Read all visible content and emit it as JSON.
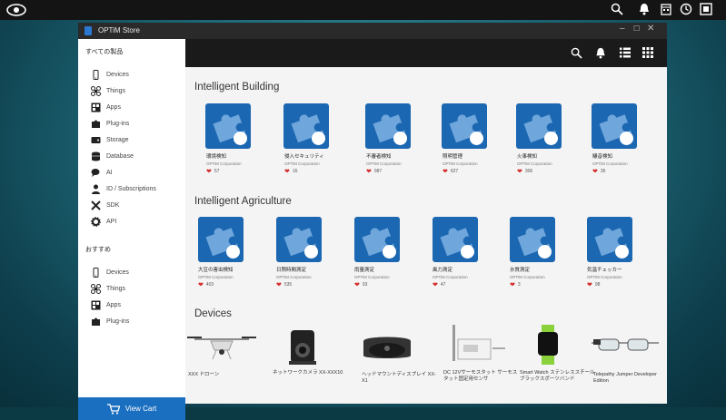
{
  "os": {
    "status_icons": [
      "search-icon",
      "bell-icon",
      "calendar-icon",
      "clock-icon",
      "window-icon"
    ]
  },
  "window": {
    "title": "OPTiM Store"
  },
  "sidebar": {
    "section_all": "すべての製品",
    "items": [
      {
        "label": "Devices",
        "icon": "phone-icon"
      },
      {
        "label": "Things",
        "icon": "drone-icon"
      },
      {
        "label": "Apps",
        "icon": "apps-icon"
      },
      {
        "label": "Plug-ins",
        "icon": "puzzle-icon"
      },
      {
        "label": "Storage",
        "icon": "storage-icon"
      },
      {
        "label": "Database",
        "icon": "database-icon"
      },
      {
        "label": "AI",
        "icon": "chat-icon"
      },
      {
        "label": "ID / Subscriptions",
        "icon": "person-icon"
      },
      {
        "label": "SDK",
        "icon": "tools-icon"
      },
      {
        "label": "API",
        "icon": "gear-icon"
      }
    ],
    "section_rec": "おすすめ",
    "rec_items": [
      {
        "label": "Devices",
        "icon": "phone-icon"
      },
      {
        "label": "Things",
        "icon": "drone-icon"
      },
      {
        "label": "Apps",
        "icon": "apps-icon"
      },
      {
        "label": "Plug-ins",
        "icon": "puzzle-icon"
      }
    ],
    "view_cart": "View Cart"
  },
  "sections": [
    {
      "title": "Intelligent Building",
      "items": [
        {
          "name": "環境検知",
          "corp": "OPTiM Corporation",
          "likes": "57",
          "badge": "sensor-icon"
        },
        {
          "name": "侵入セキュリティ",
          "corp": "OPTiM Corporation",
          "likes": "16",
          "badge": "camera-icon"
        },
        {
          "name": "不審者検知",
          "corp": "OPTiM Corporation",
          "likes": "987",
          "badge": "no-person-icon"
        },
        {
          "name": "照明管理",
          "corp": "OPTiM Corporation",
          "likes": "627",
          "badge": "bulb-icon"
        },
        {
          "name": "火事検知",
          "corp": "OPTiM Corporation",
          "likes": "306",
          "badge": "fire-icon"
        },
        {
          "name": "騒音検知",
          "corp": "OPTiM Corporation",
          "likes": "36",
          "badge": "mic-icon"
        }
      ]
    },
    {
      "title": "Intelligent Agriculture",
      "items": [
        {
          "name": "大豆の害虫検知",
          "corp": "OPTiM Corporation",
          "likes": "403",
          "badge": "camera-icon"
        },
        {
          "name": "日照時間測定",
          "corp": "OPTiM Corporation",
          "likes": "535",
          "badge": "sun-icon"
        },
        {
          "name": "雨量測定",
          "corp": "OPTiM Corporation",
          "likes": "93",
          "badge": "cloud-icon"
        },
        {
          "name": "風力測定",
          "corp": "OPTiM Corporation",
          "likes": "47",
          "badge": "wind-icon"
        },
        {
          "name": "水質測定",
          "corp": "OPTiM Corporation",
          "likes": "3",
          "badge": "water-icon"
        },
        {
          "name": "気温チェッカー",
          "corp": "OPTiM Corporation",
          "likes": "98",
          "badge": "thermometer-icon"
        }
      ]
    }
  ],
  "devices_title": "Devices",
  "devices": [
    {
      "name": "XXX ドローン",
      "icon": "drone-icon"
    },
    {
      "name": "ネットワークカメラ XX-XXX10",
      "icon": "network-camera-icon"
    },
    {
      "name": "ヘッドマウントディスプレイ XX-X1",
      "icon": "vr-headset-icon"
    },
    {
      "name": "DC 12Vサーモスタット サーモスタット固定用センサ",
      "icon": "thermostat-icon"
    },
    {
      "name": "Smart Watch ステンレススチール ブラックスポーツバンド",
      "icon": "smartwatch-icon"
    },
    {
      "name": "Telepathy Jumper Developer Edition",
      "icon": "smart-glasses-icon"
    }
  ],
  "colors": {
    "tile": "#1c67b1",
    "cart": "#1b6fc0",
    "heart": "#d42a2a"
  }
}
